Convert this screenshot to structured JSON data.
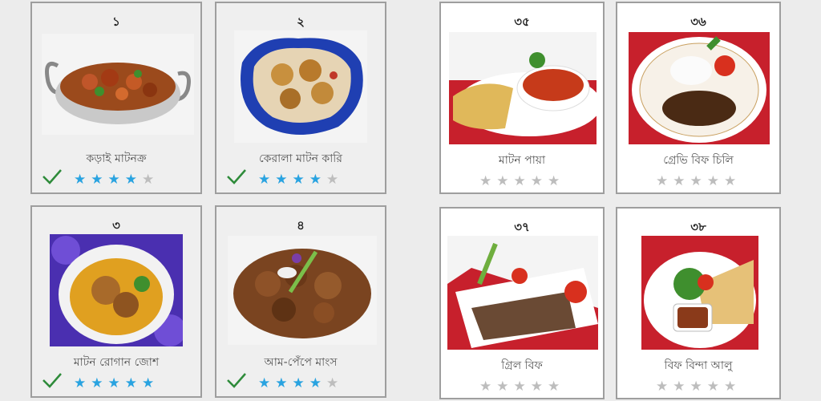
{
  "left_panel": {
    "cards": [
      {
        "number": "১",
        "title": "কড়াই মাটনক্র",
        "rating": 4,
        "completed": true
      },
      {
        "number": "২",
        "title": "কেরালা মাটন কারি",
        "rating": 4,
        "completed": true
      },
      {
        "number": "৩",
        "title": "মাটন রোগান জোশ",
        "rating": 5,
        "completed": true
      },
      {
        "number": "৪",
        "title": "আম-পেঁপে মাংস",
        "rating": 4,
        "completed": true
      }
    ]
  },
  "right_panel": {
    "cards": [
      {
        "number": "৩৫",
        "title": "মাটন পায়া",
        "rating": 0,
        "completed": false
      },
      {
        "number": "৩৬",
        "title": "গ্রেভি বিফ চিলি",
        "rating": 0,
        "completed": false
      },
      {
        "number": "৩৭",
        "title": "গ্রিল বিফ",
        "rating": 0,
        "completed": false
      },
      {
        "number": "৩৮",
        "title": "বিফ বিন্দা আলু",
        "rating": 0,
        "completed": false
      }
    ]
  },
  "colors": {
    "star_on": "#29a3e0",
    "star_off": "#bdbdbd",
    "check": "#2e8b3a",
    "card_border": "#9e9e9e"
  },
  "icons": {
    "star": "star-icon",
    "check": "checkmark-icon"
  }
}
